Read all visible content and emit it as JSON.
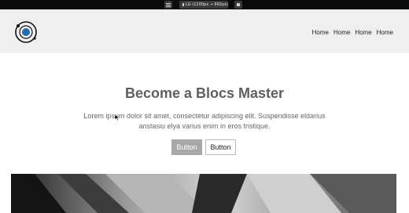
{
  "toolbar": {
    "viewport_label": "LG (1200px → 992px)"
  },
  "header": {
    "nav": [
      {
        "label": "Home"
      },
      {
        "label": "Home"
      },
      {
        "label": "Home"
      },
      {
        "label": "Home"
      }
    ]
  },
  "hero": {
    "title": "Become a Blocs Master",
    "text": "Lorem ipsum dolor sit amet, consectetur adipiscing elit. Suspendisse eldarius anstasiu elya varius enim in eros tristique.",
    "button_primary": "Button",
    "button_secondary": "Button"
  },
  "colors": {
    "header_bg": "#efefef",
    "logo_accent": "#1f6fb5",
    "primary_button": "#a9a9a9"
  },
  "icons": [
    "menu-icon",
    "laptop-icon",
    "window-icon",
    "logo-icon",
    "cursor-icon"
  ]
}
